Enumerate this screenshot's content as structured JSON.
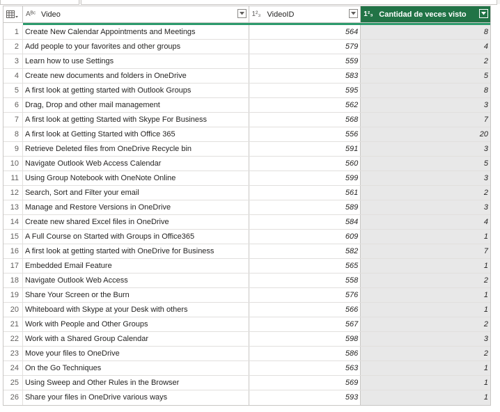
{
  "columns": [
    {
      "type_icon": "Aᴮᶜ",
      "name": "Video",
      "dropdown": "chevron-down-icon"
    },
    {
      "type_icon": "1²₃",
      "name": "VideoID",
      "dropdown": "chevron-down-icon"
    },
    {
      "type_icon": "1²₃",
      "name": "Cantidad de veces visto",
      "dropdown": "chevron-down-icon"
    }
  ],
  "selected_column_color": "#217346",
  "accent_line_color": "#2c9a6c",
  "rows": [
    {
      "n": "1",
      "video": "Create New Calendar Appointments and Meetings",
      "id": "564",
      "count": "8"
    },
    {
      "n": "2",
      "video": "Add people to your favorites and other groups",
      "id": "579",
      "count": "4"
    },
    {
      "n": "3",
      "video": "Learn how to use Settings",
      "id": "559",
      "count": "2"
    },
    {
      "n": "4",
      "video": "Create new documents and folders in OneDrive",
      "id": "583",
      "count": "5"
    },
    {
      "n": "5",
      "video": "A first look at getting started with Outlook Groups",
      "id": "595",
      "count": "8"
    },
    {
      "n": "6",
      "video": "Drag, Drop and other mail management",
      "id": "562",
      "count": "3"
    },
    {
      "n": "7",
      "video": "A first look at getting Started with Skype For Business",
      "id": "568",
      "count": "7"
    },
    {
      "n": "8",
      "video": "A first look at Getting Started with Office 365",
      "id": "556",
      "count": "20"
    },
    {
      "n": "9",
      "video": "Retrieve Deleted files from OneDrive Recycle bin",
      "id": "591",
      "count": "3"
    },
    {
      "n": "10",
      "video": "Navigate Outlook Web Access Calendar",
      "id": "560",
      "count": "5"
    },
    {
      "n": "11",
      "video": "Using Group Notebook with OneNote Online",
      "id": "599",
      "count": "3"
    },
    {
      "n": "12",
      "video": "Search, Sort and Filter your email",
      "id": "561",
      "count": "2"
    },
    {
      "n": "13",
      "video": "Manage and Restore Versions in OneDrive",
      "id": "589",
      "count": "3"
    },
    {
      "n": "14",
      "video": "Create new shared Excel files in OneDrive",
      "id": "584",
      "count": "4"
    },
    {
      "n": "15",
      "video": "A Full Course on  Started with Groups in Office365",
      "id": "609",
      "count": "1"
    },
    {
      "n": "16",
      "video": "A first look at getting started with OneDrive for Business",
      "id": "582",
      "count": "7"
    },
    {
      "n": "17",
      "video": "Embedded Email Feature",
      "id": "565",
      "count": "1"
    },
    {
      "n": "18",
      "video": "Navigate Outlook Web Access",
      "id": "558",
      "count": "2"
    },
    {
      "n": "19",
      "video": "Share Your Screen or the Burn",
      "id": "576",
      "count": "1"
    },
    {
      "n": "20",
      "video": "Whiteboard with Skype at your Desk with others",
      "id": "566",
      "count": "1"
    },
    {
      "n": "21",
      "video": "Work with People and Other Groups",
      "id": "567",
      "count": "2"
    },
    {
      "n": "22",
      "video": "Work with a Shared Group Calendar",
      "id": "598",
      "count": "3"
    },
    {
      "n": "23",
      "video": "Move your files to OneDrive",
      "id": "586",
      "count": "2"
    },
    {
      "n": "24",
      "video": "On the Go Techniques",
      "id": "563",
      "count": "1"
    },
    {
      "n": "25",
      "video": "Using Sweep and Other Rules in the Browser",
      "id": "569",
      "count": "1"
    },
    {
      "n": "26",
      "video": "Share your files in OneDrive various ways",
      "id": "593",
      "count": "1"
    }
  ]
}
